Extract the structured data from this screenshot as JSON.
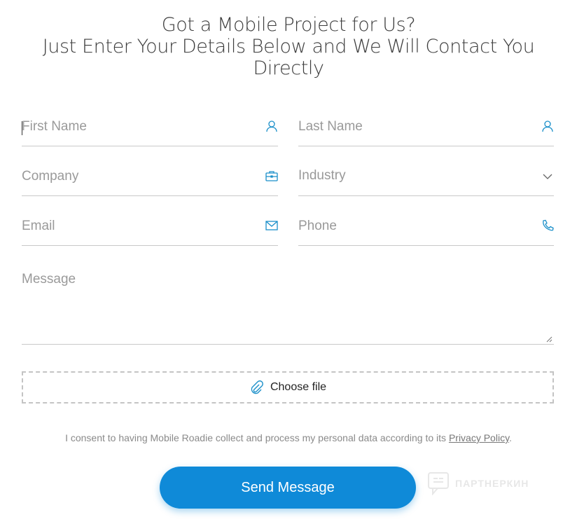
{
  "heading": {
    "line1": "Got a Mobile Project for Us?",
    "line2": "Just Enter Your Details Below and We Will Contact You",
    "line3": "Directly"
  },
  "form": {
    "first_name": {
      "placeholder": "First Name",
      "value": "",
      "icon": "user-icon"
    },
    "last_name": {
      "placeholder": "Last Name",
      "value": "",
      "icon": "user-icon"
    },
    "company": {
      "placeholder": "Company",
      "value": "",
      "icon": "briefcase-icon"
    },
    "industry": {
      "placeholder": "Industry",
      "value": "",
      "icon": "chevron-down-icon"
    },
    "email": {
      "placeholder": "Email",
      "value": "",
      "icon": "envelope-icon"
    },
    "phone": {
      "placeholder": "Phone",
      "value": "",
      "icon": "phone-icon"
    },
    "message": {
      "placeholder": "Message",
      "value": ""
    }
  },
  "file": {
    "label": "Choose file",
    "icon": "paperclip-icon"
  },
  "consent": {
    "text": "I consent to having Mobile Roadie collect and process my personal data according to its ",
    "link": "Privacy Policy",
    "suffix": "."
  },
  "submit": {
    "label": "Send Message"
  },
  "watermark": {
    "text": "ПАРТНЕРКИН"
  },
  "colors": {
    "accent": "#0f8ad8",
    "icon": "#1a8fc9"
  }
}
